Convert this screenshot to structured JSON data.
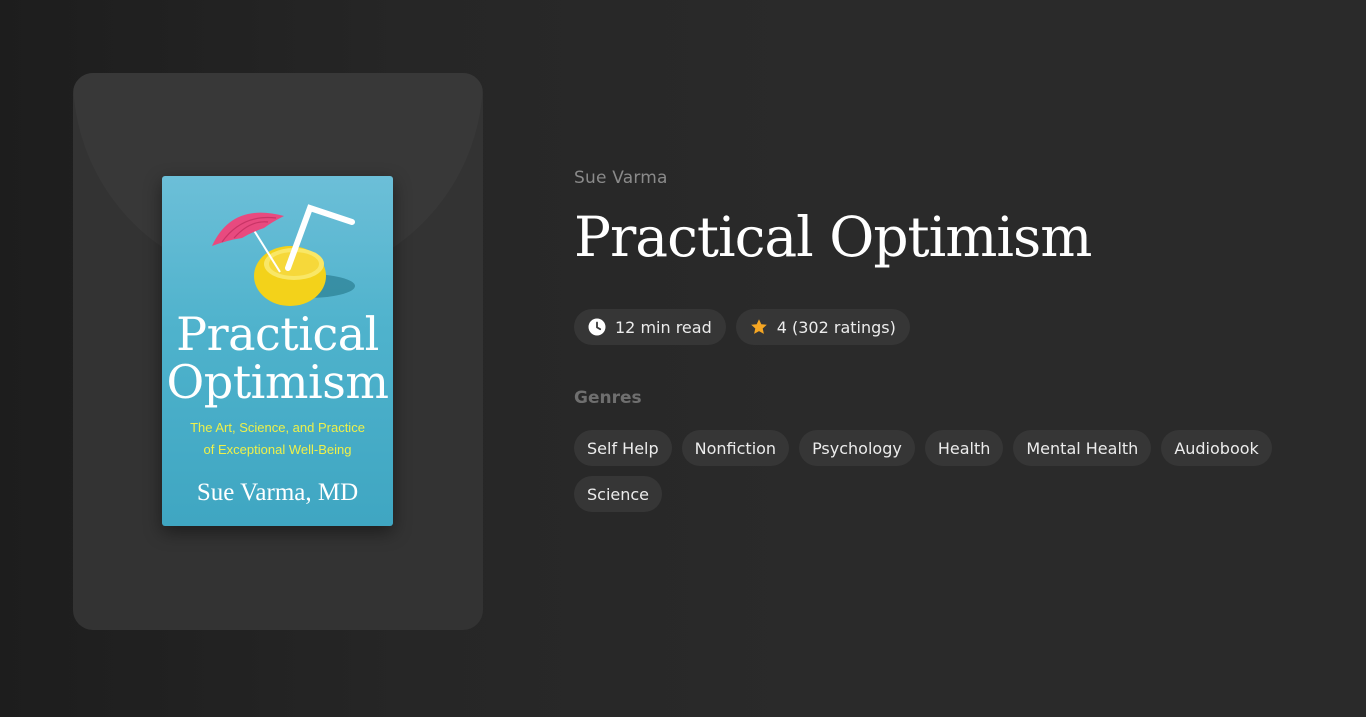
{
  "book": {
    "author": "Sue Varma",
    "title": "Practical Optimism",
    "cover": {
      "title_line1": "Practical",
      "title_line2": "Optimism",
      "subtitle_line1": "The Art, Science, and Practice",
      "subtitle_line2": "of Exceptional Well-Being",
      "author": "Sue Varma, MD"
    }
  },
  "meta": {
    "read_time": "12 min read",
    "rating": "4 (302 ratings)",
    "clock_icon": "clock-icon",
    "star_icon": "star-icon",
    "star_color": "#f5a623"
  },
  "genres": {
    "label": "Genres",
    "items": [
      "Self Help",
      "Nonfiction",
      "Psychology",
      "Health",
      "Mental Health",
      "Audiobook",
      "Science"
    ]
  },
  "colors": {
    "background": "#2a2a2a",
    "panel": "#333333",
    "pill": "#363636",
    "cover_blue": "#4eb2cc",
    "cover_subtitle": "#eef04a"
  }
}
